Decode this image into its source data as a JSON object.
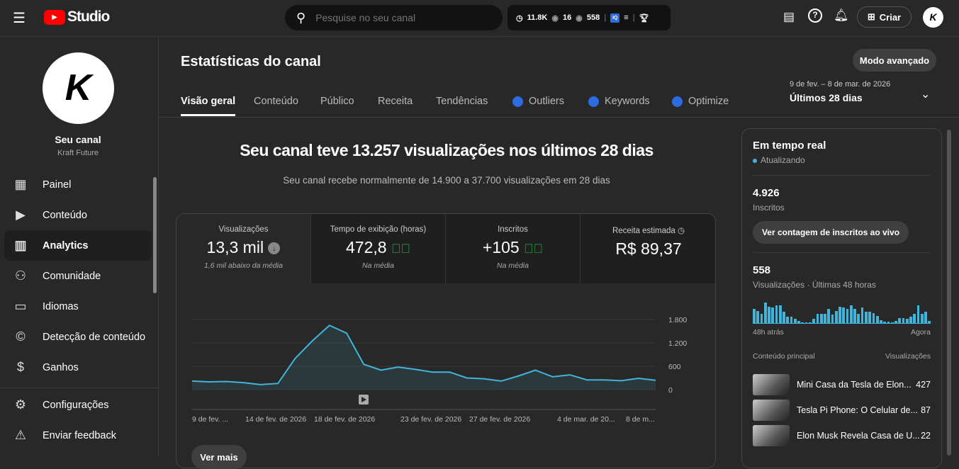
{
  "header": {
    "logo": "Studio",
    "search_placeholder": "Pesquise no seu canal",
    "stats": {
      "watch": "11.8K",
      "live": "16",
      "views": "558"
    },
    "create": "Criar"
  },
  "sidebar": {
    "channel_name": "Seu canal",
    "channel_handle": "Kraft Future",
    "items": [
      {
        "label": "Painel",
        "icon": "dashboard-icon"
      },
      {
        "label": "Conteúdo",
        "icon": "content-icon"
      },
      {
        "label": "Analytics",
        "icon": "analytics-icon"
      },
      {
        "label": "Comunidade",
        "icon": "community-icon"
      },
      {
        "label": "Idiomas",
        "icon": "subtitles-icon"
      },
      {
        "label": "Detecção de conteúdo",
        "icon": "copyright-icon"
      },
      {
        "label": "Ganhos",
        "icon": "dollar-icon"
      }
    ],
    "settings": "Configurações",
    "feedback": "Enviar feedback"
  },
  "page": {
    "title": "Estatísticas do canal",
    "advanced": "Modo avançado",
    "date_range": "9 de fev. – 8 de mar. de 2026",
    "period": "Últimos 28 dias",
    "tabs": [
      "Visão geral",
      "Conteúdo",
      "Público",
      "Receita",
      "Tendências",
      "Outliers",
      "Keywords",
      "Optimize"
    ],
    "headline": "Seu canal teve 13.257 visualizações nos últimos 28 dias",
    "subhead": "Seu canal recebe normalmente de 14.900 a 37.700 visualizações em 28 dias",
    "metrics": [
      {
        "label": "Visualizações",
        "value": "13,3 mil",
        "sub": "1,6 mil abaixo da média"
      },
      {
        "label": "Tempo de exibição (horas)",
        "value": "472,8",
        "sub": "Na média"
      },
      {
        "label": "Inscritos",
        "value": "+105",
        "sub": "Na média"
      },
      {
        "label": "Receita estimada",
        "value": "R$ 89,37",
        "sub": ""
      }
    ],
    "see_more": "Ver mais"
  },
  "chart_data": {
    "type": "area",
    "ylim": [
      0,
      1800
    ],
    "yticks": [
      "0",
      "600",
      "1.200",
      "1.800"
    ],
    "xticks": [
      "9 de fev. ...",
      "14 de fev. de 2026",
      "18 de fev. de 2026",
      "23 de fev. de 2026",
      "27 de fev. de 2026",
      "4 de mar. de 20...",
      "8 de m..."
    ],
    "values": [
      220,
      200,
      210,
      180,
      130,
      160,
      800,
      1250,
      1650,
      1450,
      650,
      500,
      580,
      520,
      450,
      450,
      300,
      280,
      220,
      350,
      500,
      330,
      380,
      250,
      250,
      230,
      290,
      240
    ],
    "color": "#41b4d9"
  },
  "realtime": {
    "title": "Em tempo real",
    "status": "Atualizando",
    "subs": "4.926",
    "subs_label": "Inscritos",
    "live_btn": "Ver contagem de inscritos ao vivo",
    "views": "558",
    "views_label": "Visualizações · Últimas 48 horas",
    "from": "48h atrás",
    "to": "Agora",
    "bars": [
      0.7,
      0.6,
      0.45,
      1,
      0.8,
      0.75,
      0.85,
      0.85,
      0.55,
      0.3,
      0.3,
      0.2,
      0.1,
      0,
      0.05,
      0,
      0.2,
      0.45,
      0.45,
      0.45,
      0.7,
      0.4,
      0.6,
      0.8,
      0.75,
      0.7,
      0.85,
      0.7,
      0.45,
      0.75,
      0.55,
      0.55,
      0.5,
      0.35,
      0.15,
      0.08,
      0.08,
      0.05,
      0.1,
      0.25,
      0.25,
      0.2,
      0.3,
      0.45,
      0.85,
      0.45,
      0.55,
      0.12
    ],
    "top_header": "Conteúdo principal",
    "top_views_header": "Visualizações",
    "videos": [
      {
        "title": "Mini Casa da Tesla de Elon...",
        "views": "427"
      },
      {
        "title": "Tesla Pi Phone: O Celular de...",
        "views": "87"
      },
      {
        "title": "Elon Musk Revela Casa de U...",
        "views": "22"
      }
    ]
  }
}
